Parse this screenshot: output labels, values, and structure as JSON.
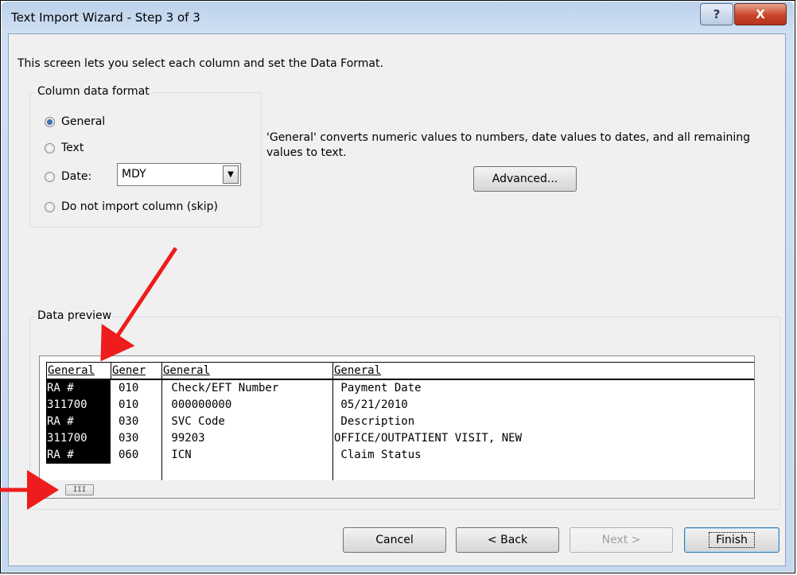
{
  "window": {
    "title": "Text Import Wizard - Step 3 of 3",
    "help_glyph": "?",
    "close_glyph": "X"
  },
  "intro": "This screen lets you select each column and set the Data Format.",
  "column_format": {
    "legend": "Column data format",
    "options": [
      {
        "label": "General",
        "selected": true
      },
      {
        "label": "Text",
        "selected": false
      },
      {
        "label": "Date:",
        "selected": false
      },
      {
        "label": "Do not import column (skip)",
        "selected": false
      }
    ],
    "date_value": "MDY"
  },
  "description": "'General' converts numeric values to numbers, date values to dates, and all remaining values to text.",
  "advanced_label": "Advanced...",
  "preview": {
    "legend": "Data preview",
    "headers": [
      "General",
      "Gener",
      "General",
      "General"
    ],
    "rows": [
      [
        "RA #",
        "010",
        " Check/EFT Number",
        " Payment Date"
      ],
      [
        "311700",
        "010",
        " 000000000",
        " 05/21/2010"
      ],
      [
        "RA #",
        "030",
        " SVC Code",
        " Description"
      ],
      [
        "311700",
        "030",
        " 99203",
        "OFFICE/OUTPATIENT VISIT, NEW"
      ],
      [
        "RA #",
        "060",
        " ICN",
        " Claim Status"
      ]
    ],
    "thumb_glyph": "III"
  },
  "buttons": {
    "cancel": "Cancel",
    "back": "< Back",
    "next": "Next >",
    "finish": "Finish"
  },
  "colors": {
    "annotation_arrow": "#ee1c1c",
    "selected_column": "#000000"
  }
}
